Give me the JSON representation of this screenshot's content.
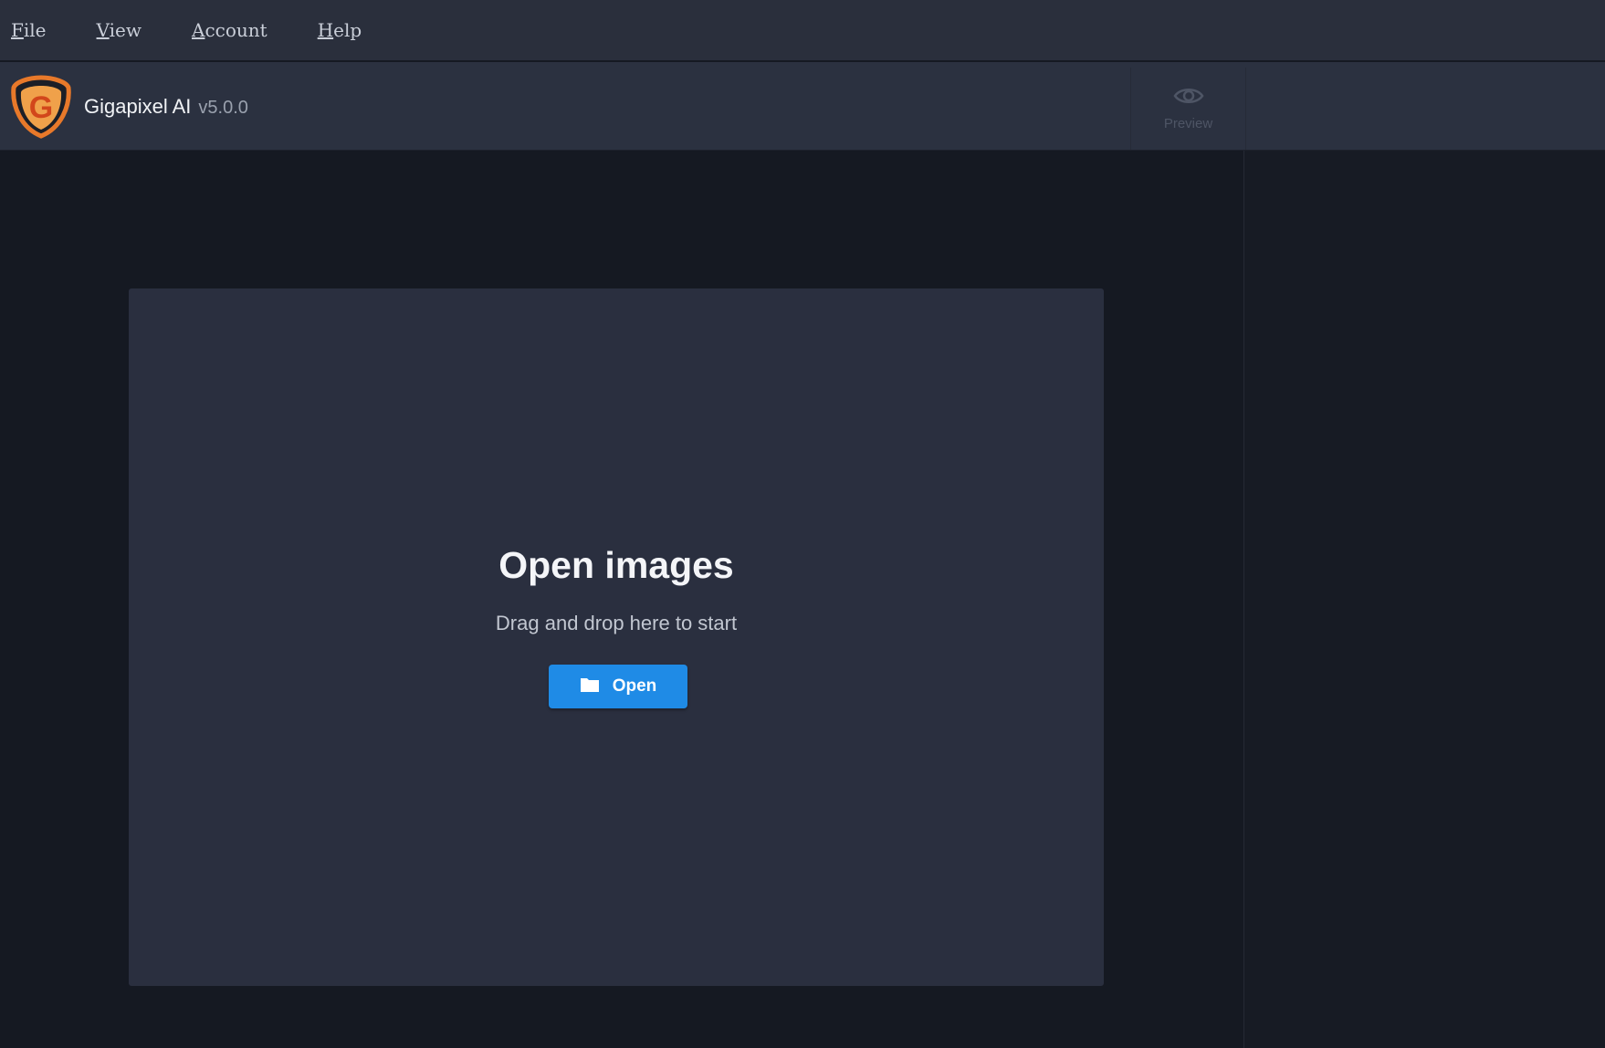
{
  "menubar": {
    "items": [
      {
        "mnemonic": "F",
        "rest": "ile"
      },
      {
        "mnemonic": "V",
        "rest": "iew"
      },
      {
        "mnemonic": "A",
        "rest": "ccount"
      },
      {
        "mnemonic": "H",
        "rest": "elp"
      }
    ]
  },
  "header": {
    "app_name": "Gigapixel AI",
    "version": "v5.0.0",
    "logo_letter": "G",
    "preview_label": "Preview"
  },
  "dropzone": {
    "title": "Open images",
    "subtitle": "Drag and drop here to start",
    "open_label": "Open"
  },
  "colors": {
    "accent": "#1f8be6",
    "logo_orange": "#e8792a",
    "background": "#151922",
    "panel": "#2a2f3f"
  },
  "icons": {
    "logo": "topaz-logo-icon",
    "preview": "eye-icon",
    "open": "folder-icon"
  }
}
